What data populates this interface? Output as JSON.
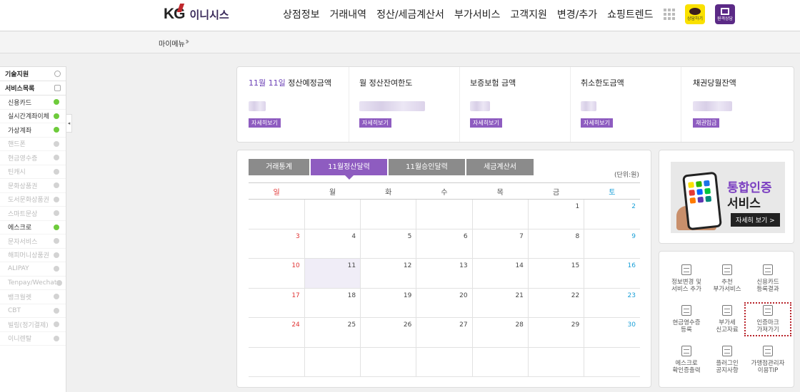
{
  "brand": {
    "kg": "KG",
    "name": "이니시스"
  },
  "nav": [
    "상점정보",
    "거래내역",
    "정산/세금계산서",
    "부가서비스",
    "고객지원",
    "변경/추가",
    "쇼핑트렌드"
  ],
  "header_buttons": {
    "kakao": "상담하기",
    "remote": "원격상담"
  },
  "breadcrumb": "마이메뉴",
  "sidebar": {
    "sections": [
      "기술지원",
      "서비스목록"
    ],
    "items": [
      {
        "label": "신용카드",
        "active": true
      },
      {
        "label": "실시간계좌이체",
        "active": true
      },
      {
        "label": "가상계좌",
        "active": true
      },
      {
        "label": "핸드폰",
        "active": false
      },
      {
        "label": "현금영수증",
        "active": false
      },
      {
        "label": "틴캐시",
        "active": false
      },
      {
        "label": "문화상품권",
        "active": false
      },
      {
        "label": "도서문화상품권",
        "active": false
      },
      {
        "label": "스마트문상",
        "active": false
      },
      {
        "label": "에스크로",
        "active": true
      },
      {
        "label": "문자서비스",
        "active": false
      },
      {
        "label": "해피머니상품권",
        "active": false
      },
      {
        "label": "ALIPAY",
        "active": false
      },
      {
        "label": "Tenpay/Wechat",
        "active": false
      },
      {
        "label": "뱅크월렛",
        "active": false
      },
      {
        "label": "CBT",
        "active": false
      },
      {
        "label": "빌링(정기결제)",
        "active": false
      },
      {
        "label": "이니렌탈",
        "active": false
      }
    ]
  },
  "summary": [
    {
      "highlight": "11월 11일",
      "title": " 정산예정금액",
      "button": "자세히보기"
    },
    {
      "highlight": "",
      "title": "월 정산잔여한도",
      "button": "자세히보기"
    },
    {
      "highlight": "",
      "title": "보증보험 금액",
      "button": "자세히보기"
    },
    {
      "highlight": "",
      "title": "취소한도금액",
      "button": "자세히보기"
    },
    {
      "highlight": "",
      "title": "채권당월잔액",
      "button": "채권입금"
    }
  ],
  "calendar": {
    "tabs": [
      "거래통계",
      "11월정산달력",
      "11월승인달력",
      "세금계산서"
    ],
    "active_tab": 1,
    "unit": "(단위:원)",
    "weekdays": [
      "일",
      "월",
      "화",
      "수",
      "목",
      "금",
      "토"
    ],
    "weeks": [
      [
        "",
        "",
        "",
        "",
        "",
        "1",
        "2"
      ],
      [
        "3",
        "4",
        "5",
        "6",
        "7",
        "8",
        "9"
      ],
      [
        "10",
        "11",
        "12",
        "13",
        "14",
        "15",
        "16"
      ],
      [
        "17",
        "18",
        "19",
        "20",
        "21",
        "22",
        "23"
      ],
      [
        "24",
        "25",
        "26",
        "27",
        "28",
        "29",
        "30"
      ],
      [
        "",
        "",
        "",
        "",
        "",
        "",
        ""
      ]
    ],
    "today": "11"
  },
  "ad": {
    "line1": "통합인증",
    "line2": "서비스",
    "button": "자세히 보기 >"
  },
  "quick_menu": [
    {
      "label": "정보변경 및\n서비스 추가"
    },
    {
      "label": "추천\n부가서비스"
    },
    {
      "label": "신용카드\n등록결과"
    },
    {
      "label": "현금영수증\n등록"
    },
    {
      "label": "부가세\n신고자료"
    },
    {
      "label": "인증마크\n가져가기",
      "selected": true
    },
    {
      "label": "에스크로\n확인증출력"
    },
    {
      "label": "플러그인\n공지사항"
    },
    {
      "label": "가맹점관리자\n이용TIP"
    }
  ]
}
